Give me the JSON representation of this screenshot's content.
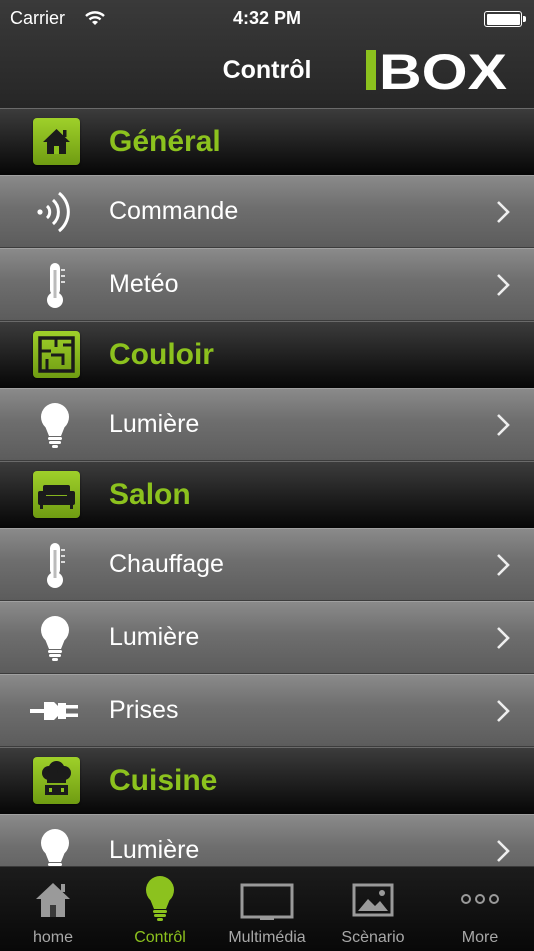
{
  "status_bar": {
    "carrier": "Carrier",
    "time": "4:32 PM"
  },
  "nav": {
    "title": "Contrôl",
    "logo_text": "IBOX"
  },
  "colors": {
    "accent": "#8cc21e",
    "row_bg": "#6e6e6e",
    "section_bg": "#1e1e1e",
    "tab_inactive": "#a8a8a8"
  },
  "sections": [
    {
      "title": "Général",
      "icon": "home-icon",
      "rows": [
        {
          "label": "Commande",
          "icon": "signal-waves-icon"
        },
        {
          "label": "Metéo",
          "icon": "thermometer-icon"
        }
      ]
    },
    {
      "title": "Couloir",
      "icon": "floor-plan-icon",
      "rows": [
        {
          "label": "Lumière",
          "icon": "lightbulb-icon"
        }
      ]
    },
    {
      "title": "Salon",
      "icon": "sofa-icon",
      "rows": [
        {
          "label": "Chauffage",
          "icon": "thermometer-icon"
        },
        {
          "label": "Lumière",
          "icon": "lightbulb-icon"
        },
        {
          "label": "Prises",
          "icon": "plug-icon"
        }
      ]
    },
    {
      "title": "Cuisine",
      "icon": "chef-hat-icon",
      "rows": [
        {
          "label": "Lumière",
          "icon": "lightbulb-icon"
        }
      ]
    }
  ],
  "tabs": [
    {
      "label": "home",
      "icon": "home-icon",
      "active": false
    },
    {
      "label": "Contrôl",
      "icon": "lightbulb-icon",
      "active": true
    },
    {
      "label": "Multimédia",
      "icon": "tv-icon",
      "active": false
    },
    {
      "label": "Scènario",
      "icon": "picture-icon",
      "active": false
    },
    {
      "label": "More",
      "icon": "more-icon",
      "active": false
    }
  ]
}
